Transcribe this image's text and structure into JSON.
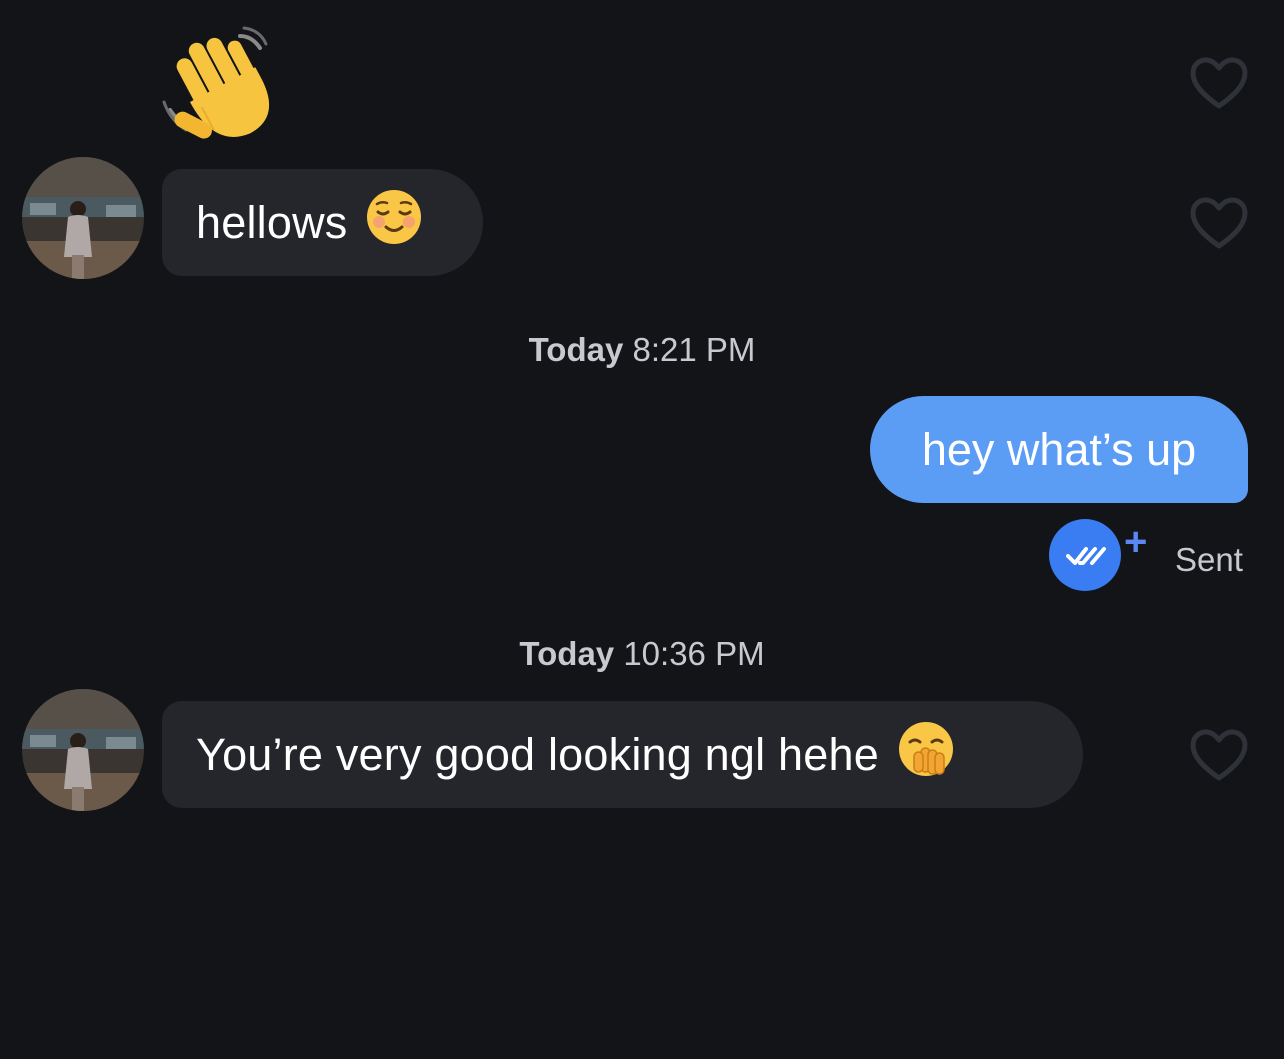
{
  "thread": {
    "wave_emoji": "👋",
    "messages": [
      {
        "direction": "incoming",
        "text": "hellows",
        "emoji": "☺️"
      },
      {
        "direction": "outgoing",
        "text": "hey what’s up"
      },
      {
        "direction": "incoming",
        "text": "You’re very good looking ngl hehe",
        "emoji": "🤭"
      }
    ],
    "timestamps": [
      {
        "day": "Today",
        "time": "8:21 PM"
      },
      {
        "day": "Today",
        "time": "10:36 PM"
      }
    ],
    "receipt": {
      "status": "Sent",
      "icon": "double-check-icon",
      "plus": "+"
    }
  },
  "colors": {
    "background": "#131418",
    "incoming_bubble": "#24262c",
    "outgoing_bubble": "#5b9df5",
    "receipt_blue": "#3a7cf2",
    "heart_outline": "#2f3238",
    "meta_text": "#c7c9cf"
  }
}
